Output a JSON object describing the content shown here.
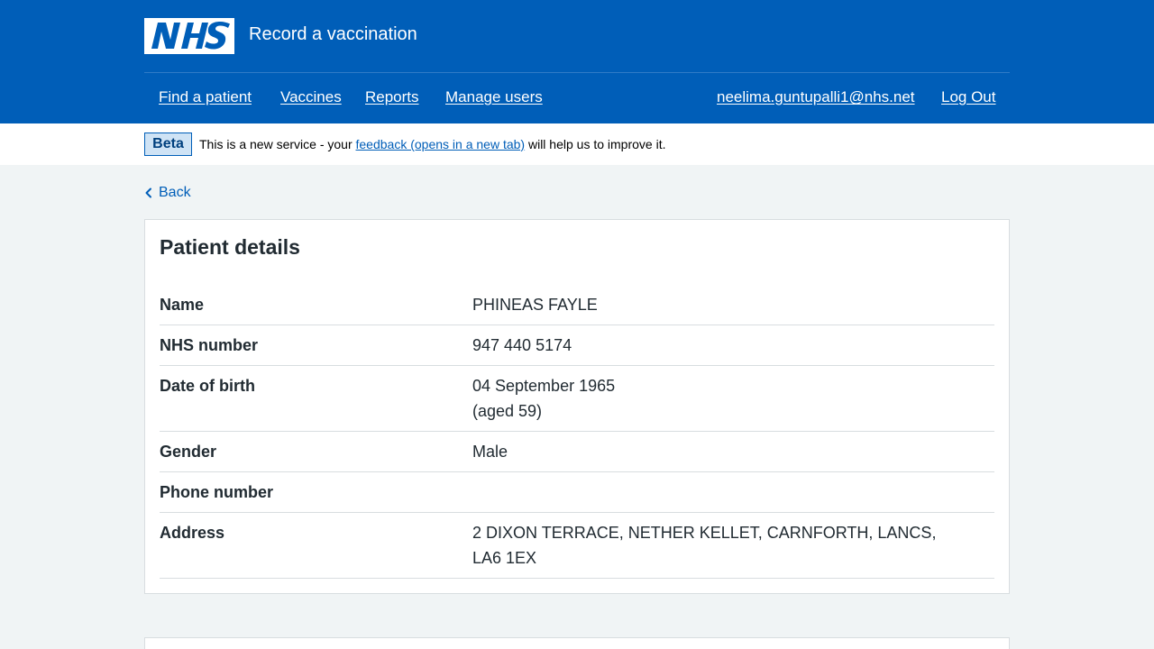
{
  "header": {
    "logo_text": "NHS",
    "service_name": "Record a vaccination",
    "nav": {
      "find_patient": "Find a patient",
      "vaccines": "Vaccines",
      "reports": "Reports",
      "manage_users": "Manage users",
      "user_email": "neelima.guntupalli1@nhs.net",
      "logout": "Log Out"
    }
  },
  "phase_banner": {
    "tag": "Beta",
    "text_before": "This is a new service - your ",
    "link": "feedback (opens in a new tab)",
    "text_after": " will help us to improve it."
  },
  "back_link": "Back",
  "patient_details": {
    "title": "Patient details",
    "rows": [
      {
        "key": "Name",
        "value": "PHINEAS FAYLE"
      },
      {
        "key": "NHS number",
        "value": "947 440 5174"
      },
      {
        "key": "Date of birth",
        "value": "04 September 1965",
        "value_extra": "(aged 59)"
      },
      {
        "key": "Gender",
        "value": "Male"
      },
      {
        "key": "Phone number",
        "value": ""
      },
      {
        "key": "Address",
        "value": "2 DIXON TERRACE, NETHER KELLET, CARNFORTH, LANCS, LA6 1EX"
      }
    ]
  },
  "colors": {
    "brand_blue": "#005eb8",
    "page_background": "#f0f4f5",
    "text": "#212b32",
    "tag_background": "#cfe3f5"
  }
}
